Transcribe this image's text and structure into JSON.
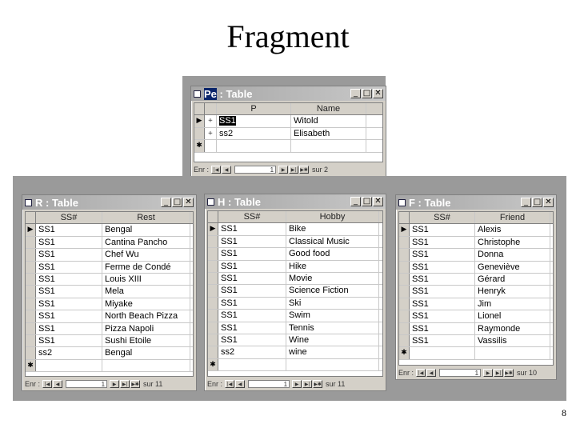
{
  "slide": {
    "title": "Fragment",
    "page_number": "8"
  },
  "windows": {
    "p": {
      "title": "P : Table",
      "title_highlight": "Pe",
      "title_rest": " : Table",
      "controls": {
        "minimize": "_",
        "maximize": "□",
        "close": "✕"
      },
      "columns": [
        "P",
        "Name"
      ],
      "rows": [
        {
          "selector": "▶",
          "expander": "+",
          "cells": [
            "SS1",
            "Witold"
          ]
        },
        {
          "selector": "",
          "expander": "+",
          "cells": [
            "ss2",
            "Elisabeth"
          ]
        },
        {
          "selector": "✱",
          "expander": "",
          "cells": [
            "",
            ""
          ]
        }
      ],
      "nav": {
        "label": "Enr :",
        "record": "1",
        "total": "sur 2"
      }
    },
    "r": {
      "title": "R : Table",
      "controls": {
        "minimize": "_",
        "maximize": "□",
        "close": "✕"
      },
      "columns": [
        "SS#",
        "Rest"
      ],
      "rows": [
        {
          "selector": "▶",
          "cells": [
            "SS1",
            "Bengal"
          ]
        },
        {
          "selector": "",
          "cells": [
            "SS1",
            "Cantina Pancho"
          ]
        },
        {
          "selector": "",
          "cells": [
            "SS1",
            "Chef Wu"
          ]
        },
        {
          "selector": "",
          "cells": [
            "SS1",
            "Ferme de Condé"
          ]
        },
        {
          "selector": "",
          "cells": [
            "SS1",
            "Louis XIII"
          ]
        },
        {
          "selector": "",
          "cells": [
            "SS1",
            "Mela"
          ]
        },
        {
          "selector": "",
          "cells": [
            "SS1",
            "Miyake"
          ]
        },
        {
          "selector": "",
          "cells": [
            "SS1",
            "North Beach Pizza"
          ]
        },
        {
          "selector": "",
          "cells": [
            "SS1",
            "Pizza Napoli"
          ]
        },
        {
          "selector": "",
          "cells": [
            "SS1",
            "Sushi Etoile"
          ]
        },
        {
          "selector": "",
          "cells": [
            "ss2",
            "Bengal"
          ]
        },
        {
          "selector": "✱",
          "cells": [
            "",
            ""
          ]
        }
      ],
      "nav": {
        "label": "Enr :",
        "record": "1",
        "total": "sur 11"
      }
    },
    "h": {
      "title": "H : Table",
      "controls": {
        "minimize": "_",
        "maximize": "□",
        "close": "✕"
      },
      "columns": [
        "SS#",
        "Hobby"
      ],
      "rows": [
        {
          "selector": "▶",
          "cells": [
            "SS1",
            "Bike"
          ]
        },
        {
          "selector": "",
          "cells": [
            "SS1",
            "Classical Music"
          ]
        },
        {
          "selector": "",
          "cells": [
            "SS1",
            "Good food"
          ]
        },
        {
          "selector": "",
          "cells": [
            "SS1",
            "Hike"
          ]
        },
        {
          "selector": "",
          "cells": [
            "SS1",
            "Movie"
          ]
        },
        {
          "selector": "",
          "cells": [
            "SS1",
            "Science Fiction"
          ]
        },
        {
          "selector": "",
          "cells": [
            "SS1",
            "Ski"
          ]
        },
        {
          "selector": "",
          "cells": [
            "SS1",
            "Swim"
          ]
        },
        {
          "selector": "",
          "cells": [
            "SS1",
            "Tennis"
          ]
        },
        {
          "selector": "",
          "cells": [
            "SS1",
            "Wine"
          ]
        },
        {
          "selector": "",
          "cells": [
            "ss2",
            "wine"
          ]
        },
        {
          "selector": "✱",
          "cells": [
            "",
            ""
          ]
        }
      ],
      "nav": {
        "label": "Enr :",
        "record": "1",
        "total": "sur 11"
      }
    },
    "f": {
      "title": "F : Table",
      "controls": {
        "minimize": "_",
        "maximize": "□",
        "close": "✕"
      },
      "columns": [
        "SS#",
        "Friend"
      ],
      "rows": [
        {
          "selector": "▶",
          "cells": [
            "SS1",
            "Alexis"
          ]
        },
        {
          "selector": "",
          "cells": [
            "SS1",
            "Christophe"
          ]
        },
        {
          "selector": "",
          "cells": [
            "SS1",
            "Donna"
          ]
        },
        {
          "selector": "",
          "cells": [
            "SS1",
            "Geneviève"
          ]
        },
        {
          "selector": "",
          "cells": [
            "SS1",
            "Gérard"
          ]
        },
        {
          "selector": "",
          "cells": [
            "SS1",
            "Henryk"
          ]
        },
        {
          "selector": "",
          "cells": [
            "SS1",
            "Jim"
          ]
        },
        {
          "selector": "",
          "cells": [
            "SS1",
            "Lionel"
          ]
        },
        {
          "selector": "",
          "cells": [
            "SS1",
            "Raymonde"
          ]
        },
        {
          "selector": "",
          "cells": [
            "SS1",
            "Vassilis"
          ]
        },
        {
          "selector": "✱",
          "cells": [
            "",
            ""
          ]
        }
      ],
      "nav": {
        "label": "Enr :",
        "record": "1",
        "total": "sur 10"
      }
    }
  },
  "nav_icons": [
    "first-record-icon",
    "previous-record-icon",
    "next-record-icon",
    "last-record-icon",
    "new-record-icon"
  ],
  "colors": {
    "panel": "#9a9a9a",
    "window": "#d4d0c8",
    "title_highlight": "#0a246a"
  }
}
